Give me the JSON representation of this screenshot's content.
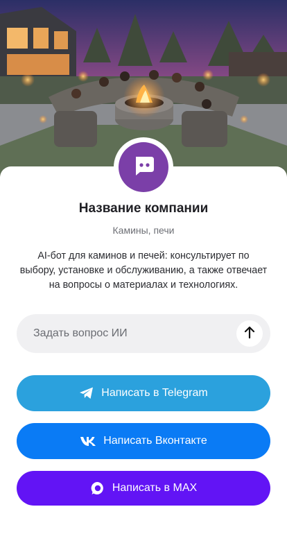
{
  "hero": {
    "image": "backyard-fire-pit-photo"
  },
  "company": {
    "avatar_icon": "chat-bot-icon",
    "avatar_color": "#7b3fa8",
    "name": "Название компании",
    "category": "Камины, печи",
    "description": "AI-бот для каминов и печей: консультирует по выбору, установке и обслуживанию, а также отвечает на вопросы о материалах и технологиях."
  },
  "ask": {
    "placeholder": "Задать вопрос ИИ",
    "value": "",
    "send_icon": "arrow-up-icon"
  },
  "buttons": {
    "telegram": {
      "label": "Написать в Telegram",
      "icon": "telegram-icon",
      "color": "#2ba1dd"
    },
    "vk": {
      "label": "Написать Вконтакте",
      "icon": "vk-icon",
      "color": "#0a7bf5"
    },
    "max": {
      "label": "Написать в MAX",
      "icon": "max-icon",
      "color": "#6214f5"
    }
  }
}
